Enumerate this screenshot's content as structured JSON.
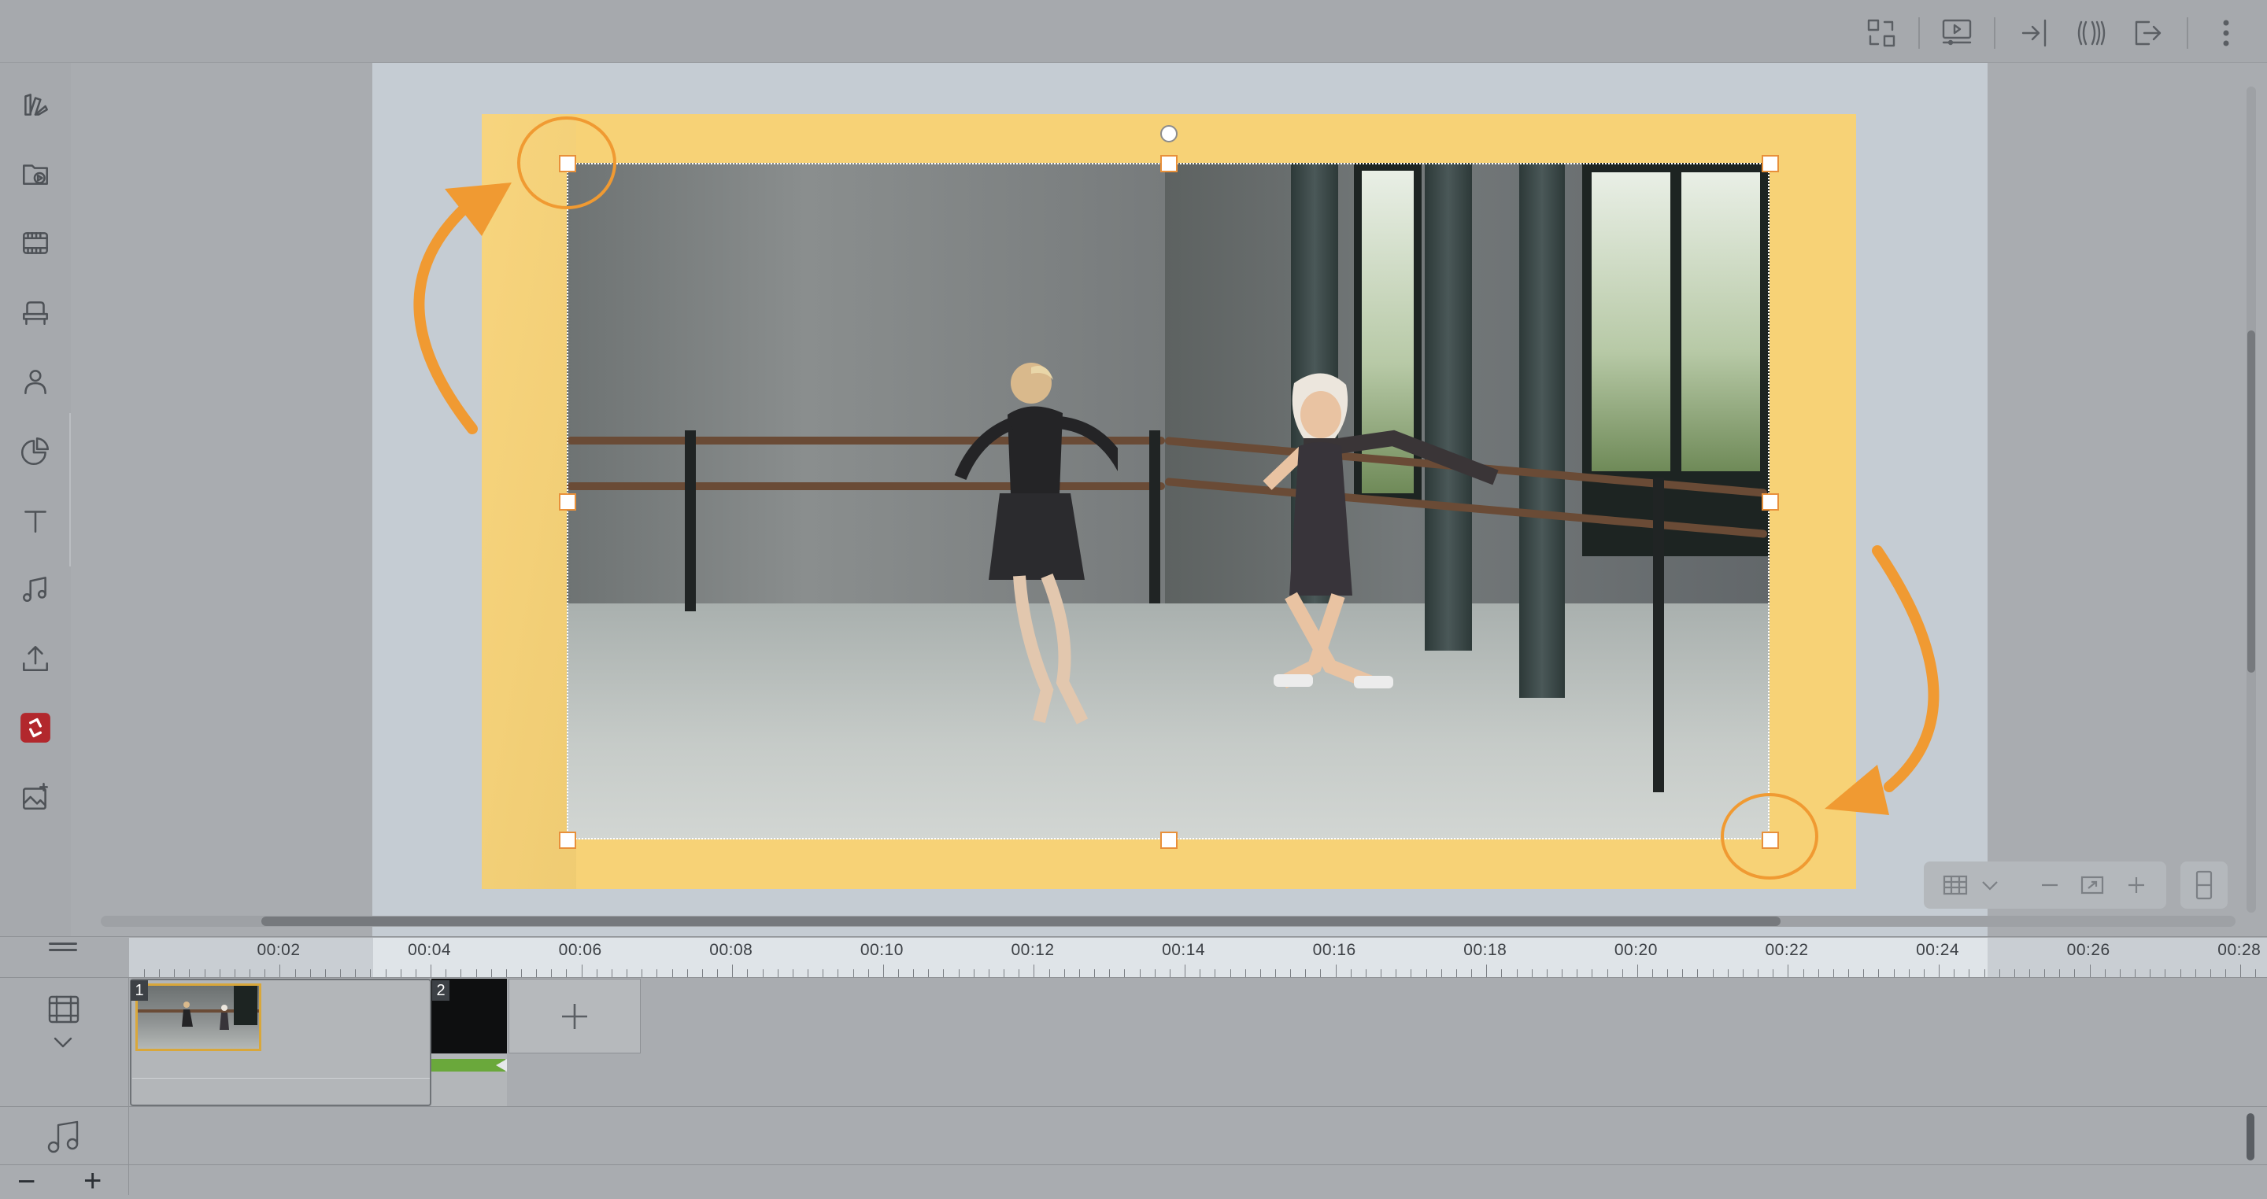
{
  "toolbar": {
    "icons": [
      "layout-swap-icon",
      "preview-icon",
      "enter-icon",
      "audio-waves-icon",
      "exit-icon",
      "more-vertical-icon"
    ]
  },
  "sidebar": {
    "items": [
      {
        "name": "compass-icon"
      },
      {
        "name": "templates-icon"
      },
      {
        "name": "media-library-icon"
      },
      {
        "name": "video-clip-icon"
      },
      {
        "name": "props-icon"
      },
      {
        "name": "character-icon"
      },
      {
        "name": "chart-icon"
      },
      {
        "name": "text-icon"
      },
      {
        "name": "music-icon"
      },
      {
        "name": "upload-icon"
      },
      {
        "name": "app-logo-icon"
      },
      {
        "name": "image-ai-icon"
      }
    ]
  },
  "canvas": {
    "slide_color": "#f7d276",
    "selection_handle_color": "#e8903a",
    "annotation_color": "#f09a32"
  },
  "timeline": {
    "ticks": [
      "00:02",
      "00:04",
      "00:06",
      "00:08",
      "00:10",
      "00:12",
      "00:14",
      "00:16",
      "00:18",
      "00:20",
      "00:22",
      "00:24",
      "00:26",
      "00:28"
    ],
    "scenes": [
      {
        "number": "1"
      },
      {
        "number": "2"
      }
    ],
    "zoom_out": "−",
    "zoom_in": "+"
  }
}
